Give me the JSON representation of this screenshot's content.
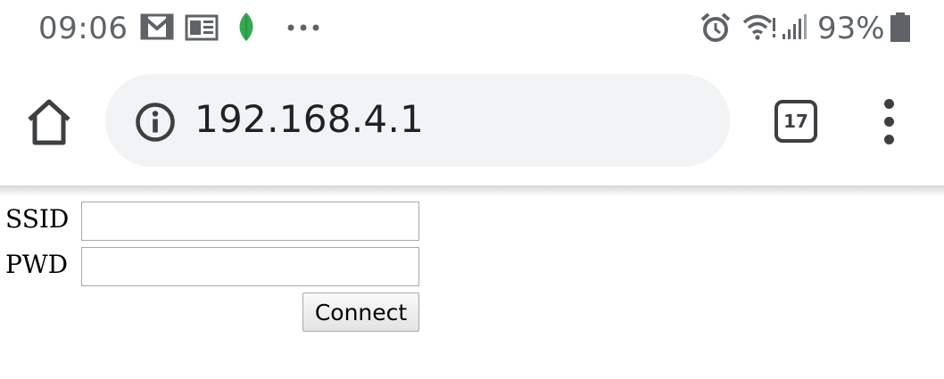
{
  "status_bar": {
    "time": "09:06",
    "battery_percent": "93%",
    "battery_level": 0.93,
    "left_icons": [
      "gmail-icon",
      "news-icon",
      "leaf-app-icon",
      "more-notifications-icon"
    ],
    "right_icons": [
      "alarm-icon",
      "wifi-icon",
      "cell-signal-icon",
      "battery-icon"
    ]
  },
  "toolbar": {
    "url": "192.168.4.1",
    "tab_count": "17"
  },
  "form": {
    "ssid_label": "SSID",
    "ssid_value": "",
    "pwd_label": "PWD",
    "pwd_value": "",
    "connect_label": "Connect"
  },
  "colors": {
    "icon_gray": "#5f6368",
    "toolbar_icon": "#3c4043",
    "omnibox_bg": "#f1f3f4",
    "leaf_green": "#34a853"
  }
}
